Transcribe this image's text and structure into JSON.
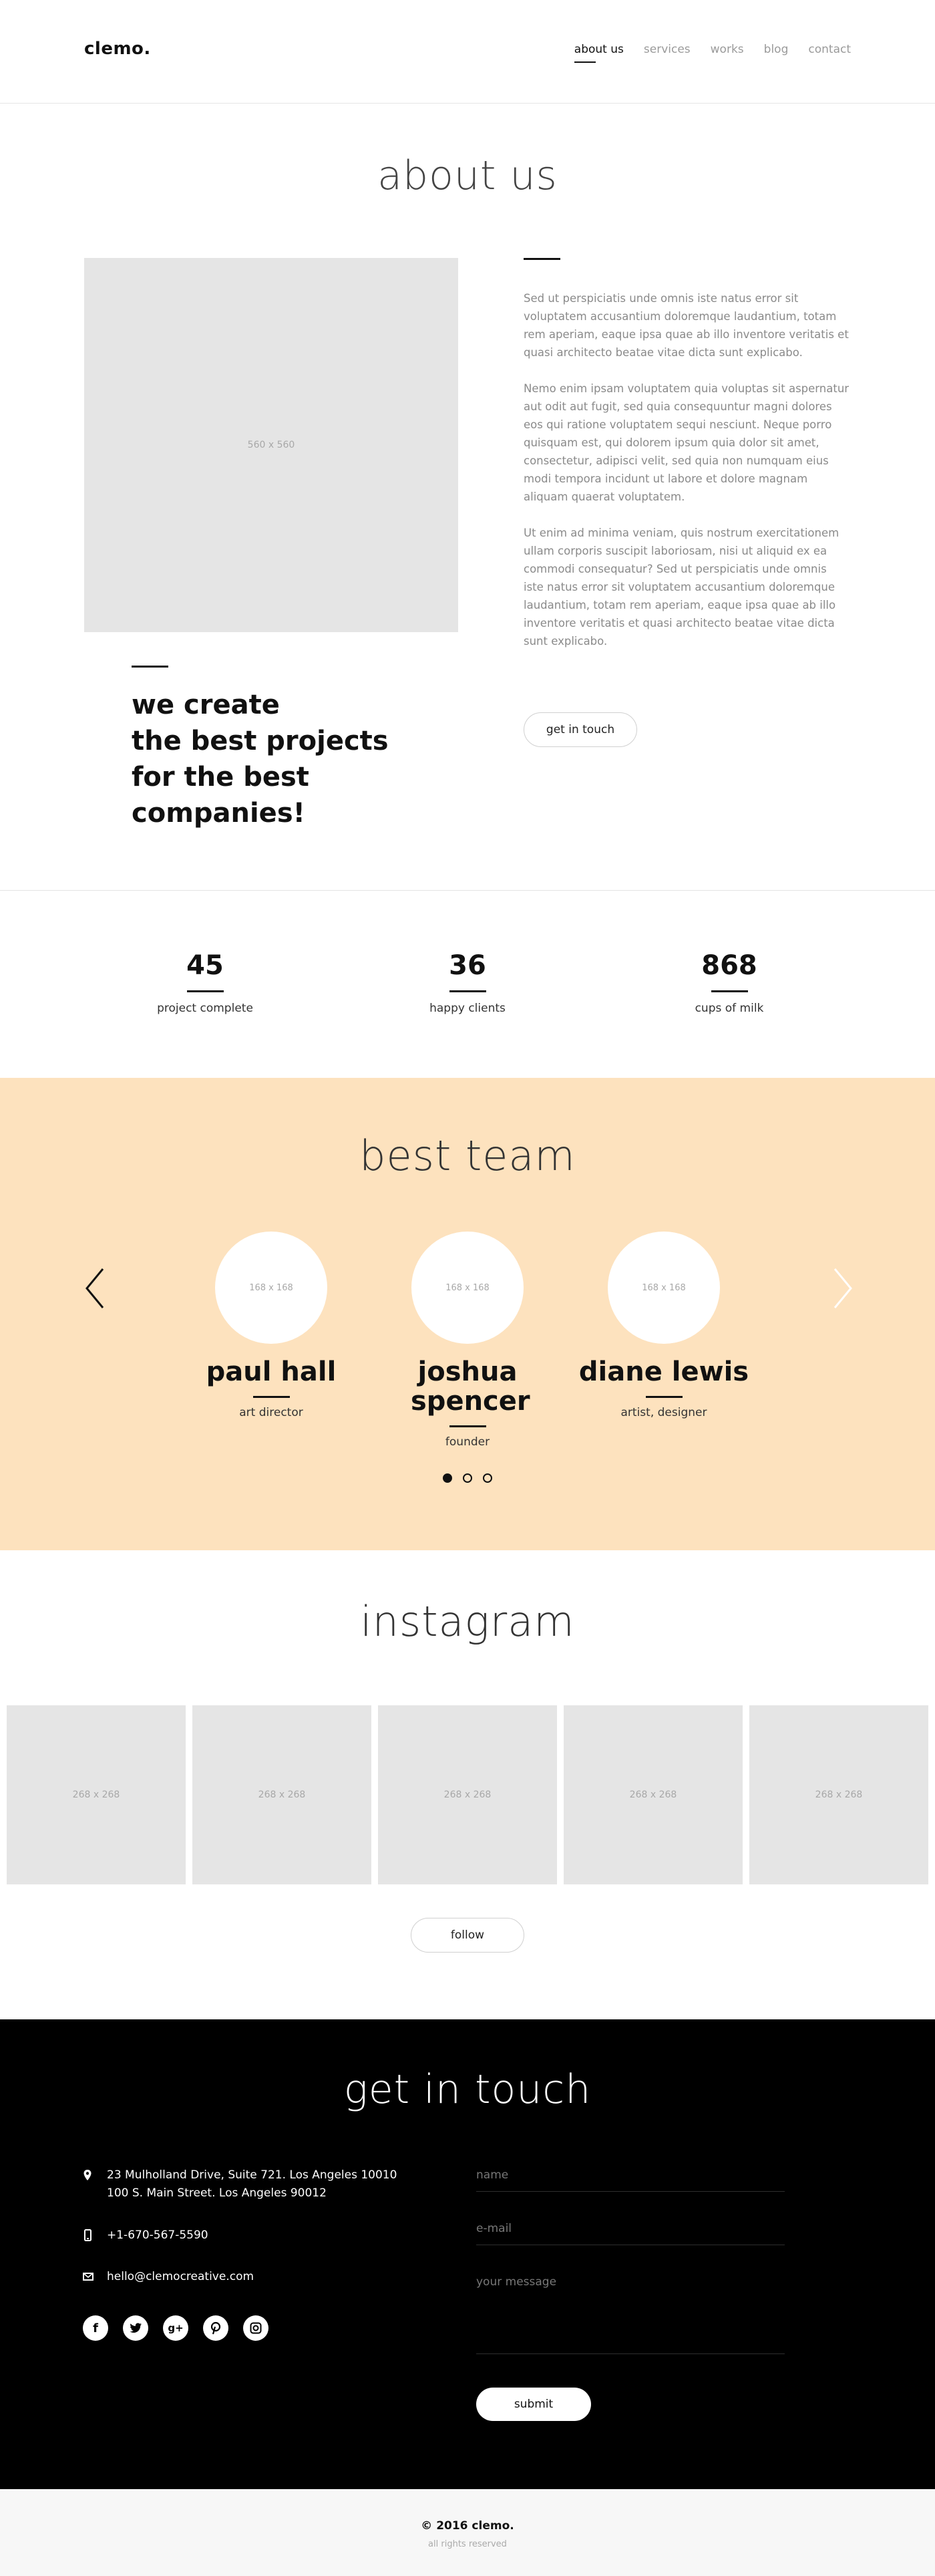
{
  "header": {
    "logo": "clemo.",
    "nav": [
      "about us",
      "services",
      "works",
      "blog",
      "contact"
    ]
  },
  "about": {
    "title": "about us",
    "image_label": "560 x 560",
    "paragraphs": [
      "Sed ut perspiciatis unde omnis iste natus error sit voluptatem accusantium doloremque laudantium, totam rem aperiam, eaque ipsa quae ab illo inventore veritatis et quasi architecto beatae vitae dicta sunt explicabo.",
      "Nemo enim ipsam voluptatem quia voluptas sit aspernatur aut odit aut fugit, sed quia consequuntur magni dolores eos qui ratione voluptatem sequi nesciunt. Neque porro quisquam est, qui dolorem ipsum quia dolor sit amet, consectetur, adipisci velit, sed quia non numquam eius modi tempora incidunt ut labore et dolore magnam aliquam quaerat voluptatem.",
      "Ut enim ad minima veniam, quis nostrum exercitationem ullam corporis suscipit laboriosam, nisi ut aliquid ex ea commodi consequatur? Sed ut perspiciatis unde omnis iste natus error sit voluptatem accusantium doloremque laudantium, totam rem aperiam, eaque ipsa quae ab illo inventore veritatis et quasi architecto beatae vitae dicta sunt explicabo."
    ],
    "button": "get in touch",
    "tagline": [
      "we create",
      "the best projects",
      "for the best",
      "companies!"
    ]
  },
  "stats": [
    {
      "value": "45",
      "label": "project complete"
    },
    {
      "value": "36",
      "label": "happy clients"
    },
    {
      "value": "868",
      "label": "cups of milk"
    }
  ],
  "team": {
    "title": "best team",
    "members": [
      {
        "avatar": "168 x 168",
        "name": "paul hall",
        "role": "art director"
      },
      {
        "avatar": "168 x 168",
        "name": "joshua spencer",
        "role": "founder"
      },
      {
        "avatar": "168 x 168",
        "name": "diane lewis",
        "role": "artist, designer"
      }
    ],
    "active_dot": 0
  },
  "instagram": {
    "title": "instagram",
    "images": [
      "268 x 268",
      "268 x 268",
      "268 x 268",
      "268 x 268",
      "268 x 268"
    ],
    "button": "follow"
  },
  "contact": {
    "title": "get in touch",
    "address_line1": "23 Mulholland Drive, Suite 721. Los Angeles 10010",
    "address_line2": "100 S. Main Street. Los Angeles 90012",
    "phone": "+1-670-567-5590",
    "email": "hello@clemocreative.com",
    "socials": [
      "facebook-icon",
      "twitter-icon",
      "google-plus-icon",
      "pinterest-icon",
      "instagram-icon"
    ],
    "form": {
      "name_placeholder": "name",
      "email_placeholder": "e-mail",
      "message_placeholder": "your message",
      "submit": "submit"
    }
  },
  "footer": {
    "copyright": "© 2016 clemo.",
    "rights": "all rights reserved"
  },
  "colors": {
    "team_background": "#fde2be",
    "contact_background": "#000000",
    "placeholder": "#e5e5e5"
  }
}
